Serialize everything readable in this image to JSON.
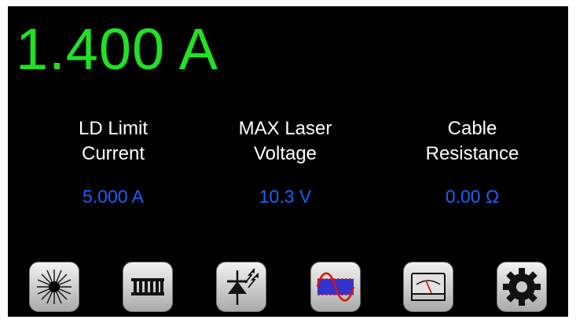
{
  "display": {
    "main_reading": "1.400 A",
    "main_color": "#21e221",
    "value_color": "#1d5fff"
  },
  "params": [
    {
      "label": "LD Limit\nCurrent",
      "value": "5.000 A"
    },
    {
      "label": "MAX Laser\nVoltage",
      "value": "10.3 V"
    },
    {
      "label": "Cable\nResistance",
      "value": "0.00 Ω"
    }
  ],
  "toolbar": {
    "buttons": [
      {
        "icon": "laser-burst-icon"
      },
      {
        "icon": "tec-module-icon"
      },
      {
        "icon": "photodiode-icon"
      },
      {
        "icon": "waveform-icon"
      },
      {
        "icon": "meter-icon"
      },
      {
        "icon": "gear-icon"
      }
    ]
  }
}
